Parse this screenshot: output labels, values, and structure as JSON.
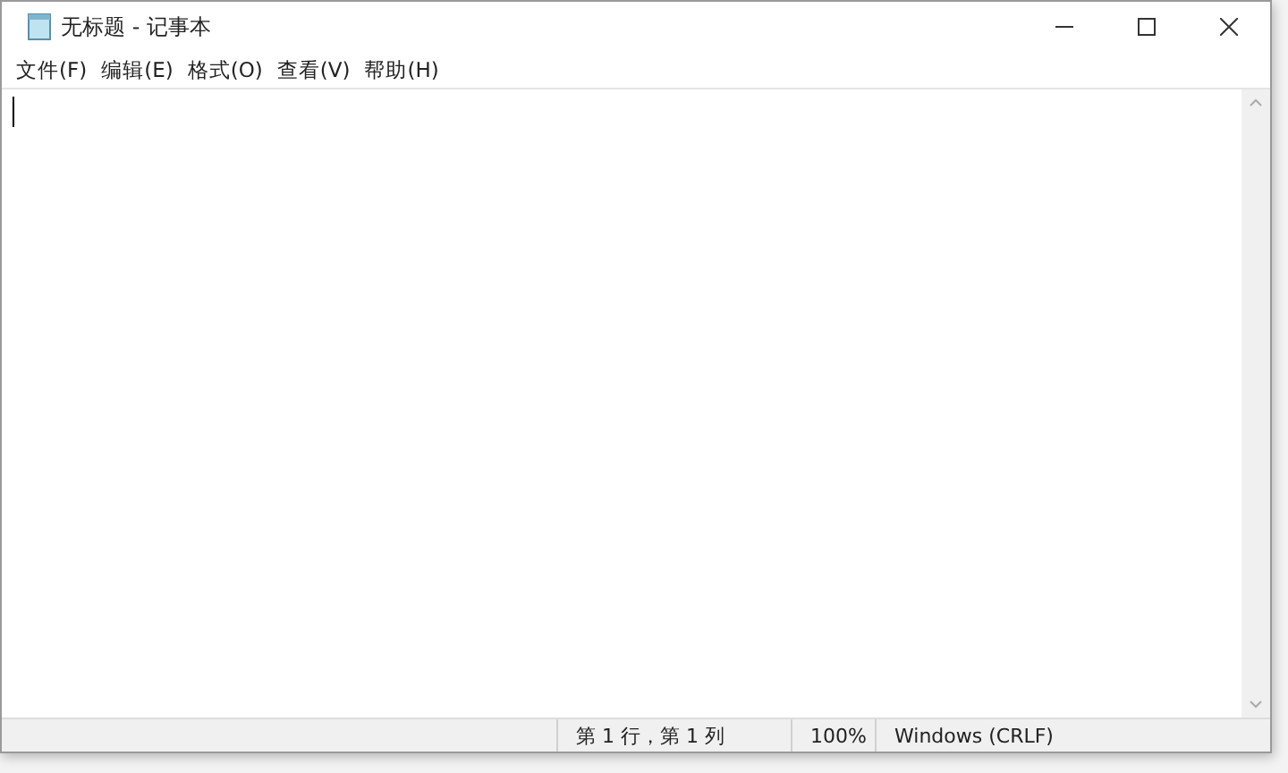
{
  "window": {
    "title": "无标题 - 记事本"
  },
  "menu": [
    "文件(F)",
    "编辑(E)",
    "格式(O)",
    "查看(V)",
    "帮助(H)"
  ],
  "status_bar": [
    "第 1 行，第 1 列",
    "100%",
    "Windows (CRLF)"
  ]
}
